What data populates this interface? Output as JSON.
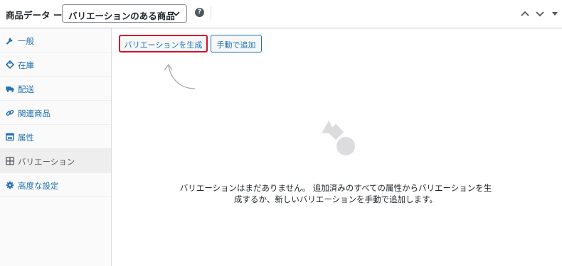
{
  "header": {
    "title": "商品データ ー",
    "product_type": "バリエーションのある商品",
    "help_symbol": "?",
    "icons": [
      "chevron-down-icon",
      "help-icon",
      "chevron-up-icon",
      "chevron-down-icon",
      "caret-down-icon"
    ]
  },
  "sidebar": {
    "tabs": [
      {
        "label": "一般",
        "icon": "wrench-icon"
      },
      {
        "label": "在庫",
        "icon": "tag-icon"
      },
      {
        "label": "配送",
        "icon": "truck-icon"
      },
      {
        "label": "関連商品",
        "icon": "link-icon"
      },
      {
        "label": "属性",
        "icon": "table-icon"
      },
      {
        "label": "バリエーション",
        "icon": "grid-icon",
        "active": true
      },
      {
        "label": "高度な設定",
        "icon": "gear-icon"
      }
    ]
  },
  "main": {
    "generate_label": "バリエーションを生成",
    "manual_add_label": "手動で追加",
    "empty_message": "バリエーションはまだありません。 追加済みのすべての属性からバリエーションを生成するか、新しいバリエーションを手動で追加します。"
  },
  "colors": {
    "link": "#2271b1",
    "highlight_border": "#d0112b",
    "active_tab_bg": "#eeeeee",
    "illustration": "#dcdcde"
  }
}
